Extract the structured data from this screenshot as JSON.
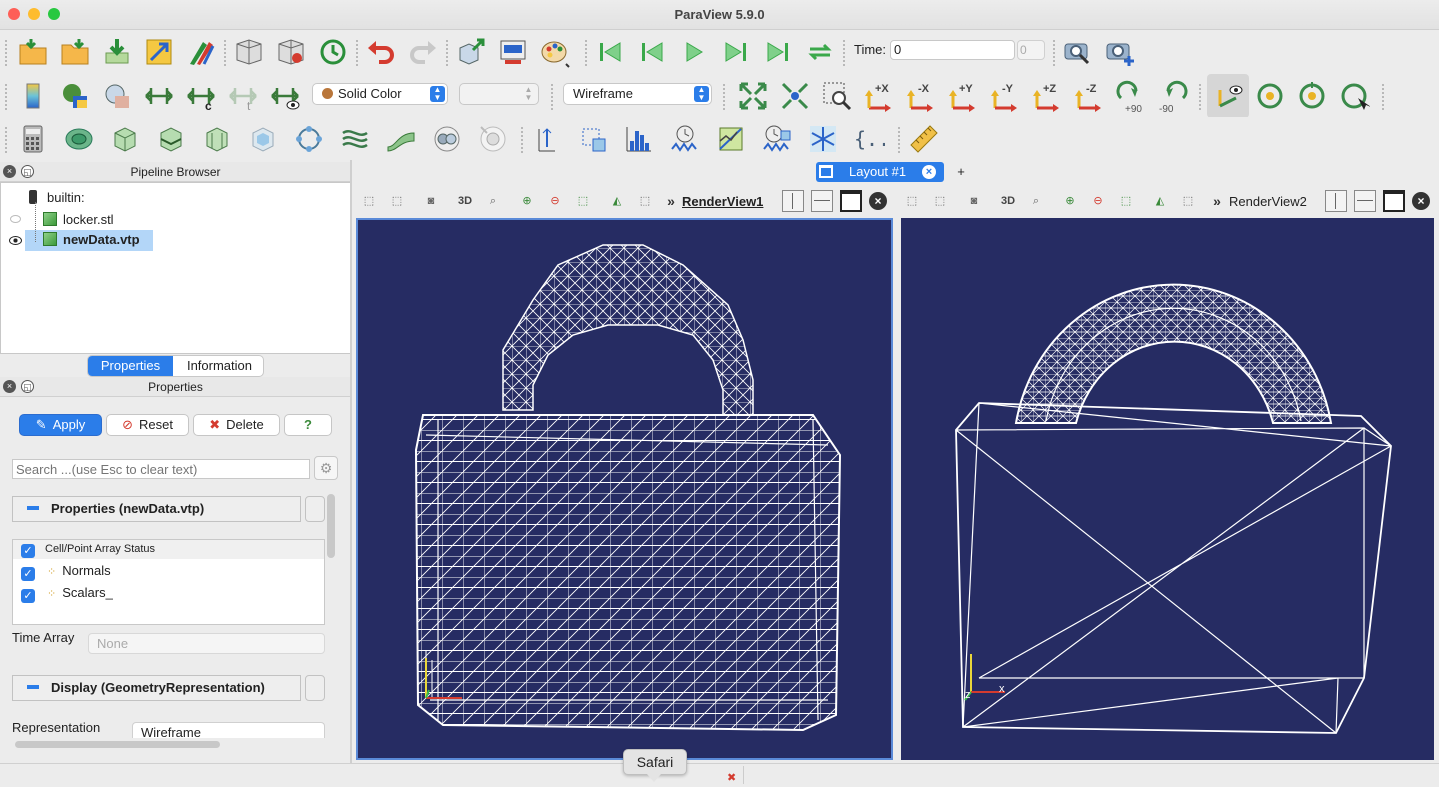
{
  "window": {
    "title": "ParaView 5.9.0"
  },
  "time": {
    "label": "Time:",
    "value": "0",
    "index": "0"
  },
  "coloring": {
    "selected": "Solid Color",
    "component": ""
  },
  "representation_combo": {
    "selected": "Wireframe"
  },
  "camera_labels": {
    "xp": "+X",
    "xm": "-X",
    "yp": "+Y",
    "ym": "-Y",
    "zp": "+Z",
    "zm": "-Z",
    "rp": "+90",
    "rm": "-90"
  },
  "calc_label": "{...}",
  "pipeline": {
    "header": "Pipeline Browser",
    "items": [
      {
        "label": "builtin:"
      },
      {
        "label": "locker.stl"
      },
      {
        "label": "newData.vtp"
      }
    ]
  },
  "props_tabs": {
    "properties": "Properties",
    "information": "Information"
  },
  "props": {
    "header": "Properties",
    "apply": "Apply",
    "reset": "Reset",
    "delete": "Delete",
    "help": "?",
    "search_placeholder": "Search ...(use Esc to clear text)",
    "section1": "Properties (newData.vtp)",
    "array_header": "Cell/Point Array Status",
    "arrays": [
      "Normals",
      "Scalars_"
    ],
    "time_array_label": "Time Array",
    "time_array_value": "None",
    "section2": "Display (GeometryRepresentation)",
    "representation_label": "Representation",
    "representation_value": "Wireframe"
  },
  "layout": {
    "tab": "Layout #1",
    "add": "+"
  },
  "views": {
    "v1": "RenderView1",
    "v2": "RenderView2",
    "mode3d": "3D"
  },
  "axes": {
    "x": "x",
    "z": "z"
  },
  "tooltip": "Safari",
  "colors": {
    "view_bg": "#262c63",
    "accent": "#2b7de9"
  }
}
